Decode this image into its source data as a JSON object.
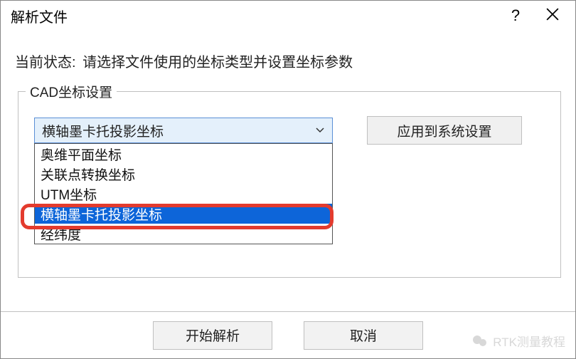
{
  "window": {
    "title": "解析文件",
    "help": "?",
    "close": "✕"
  },
  "status": {
    "label": "当前状态:",
    "text": "请选择文件使用的坐标类型并设置坐标参数"
  },
  "group": {
    "title": "CAD坐标设置",
    "combo": {
      "selected": "横轴墨卡托投影坐标",
      "options": [
        "奥维平面坐标",
        "关联点转换坐标",
        "UTM坐标",
        "横轴墨卡托投影坐标",
        "经纬度"
      ],
      "selected_index": 3
    },
    "apply_label": "应用到系统设置"
  },
  "buttons": {
    "start": "开始解析",
    "cancel": "取消"
  },
  "watermark": {
    "text": "RTK测量教程"
  }
}
